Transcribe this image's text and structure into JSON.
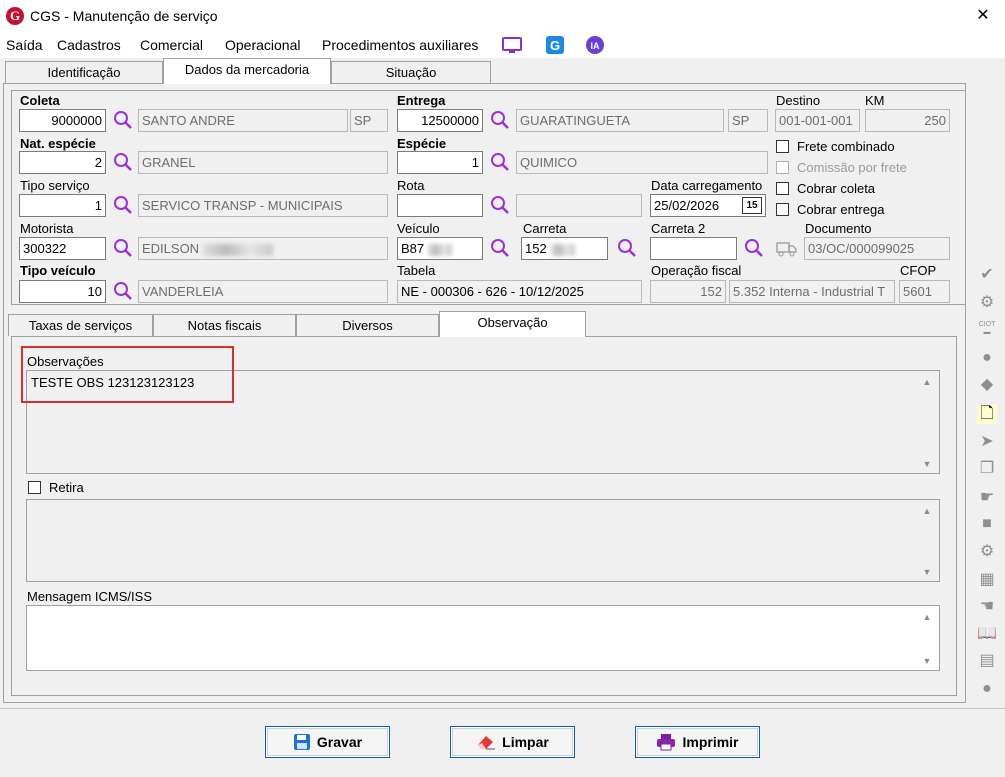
{
  "window": {
    "title": "CGS - Manutenção de serviço",
    "close": "✕",
    "logo_letter": "G"
  },
  "menu": {
    "items": [
      "Saída",
      "Cadastros",
      "Comercial",
      "Operacional",
      "Procedimentos auxiliares"
    ],
    "icons": [
      "monitor-icon",
      "g-logo-icon",
      "ia-icon"
    ],
    "ia_label": "IA"
  },
  "tabs": [
    "Identificação",
    "Dados da mercadoria",
    "Situação"
  ],
  "form": {
    "coleta": {
      "label": "Coleta",
      "code": "9000000",
      "name": "SANTO ANDRE",
      "uf": "SP"
    },
    "entrega": {
      "label": "Entrega",
      "code": "12500000",
      "name": "GUARATINGUETA",
      "uf": "SP"
    },
    "destino": {
      "label": "Destino",
      "value": "001-001-001"
    },
    "km": {
      "label": "KM",
      "value": "250"
    },
    "nat_especie": {
      "label": "Nat. espécie",
      "code": "2",
      "name": "GRANEL"
    },
    "especie": {
      "label": "Espécie",
      "code": "1",
      "name": "QUIMICO"
    },
    "tipo_servico": {
      "label": "Tipo serviço",
      "code": "1",
      "name": "SERVICO TRANSP - MUNICIPAIS"
    },
    "rota": {
      "label": "Rota",
      "code": "",
      "name": ""
    },
    "data_carregamento": {
      "label": "Data carregamento",
      "value": "25/02/2026",
      "cal": "15"
    },
    "motorista": {
      "label": "Motorista",
      "code": "300322",
      "name": "EDILSON"
    },
    "veiculo": {
      "label": "Veículo",
      "value": "B87"
    },
    "carreta": {
      "label": "Carreta",
      "value": "152"
    },
    "carreta2": {
      "label": "Carreta 2",
      "value": ""
    },
    "documento": {
      "label": "Documento",
      "value": "03/OC/000099025"
    },
    "tipo_veiculo": {
      "label": "Tipo veículo",
      "code": "10",
      "name": "VANDERLEIA"
    },
    "tabela": {
      "label": "Tabela",
      "value": "NE - 000306 - 626 - 10/12/2025"
    },
    "operacao_fiscal": {
      "label": "Operação fiscal",
      "code": "152",
      "value": "5.352  Interna - Industrial  T"
    },
    "cfop": {
      "label": "CFOP",
      "value": "5601"
    },
    "checks": {
      "frete_combinado": "Frete combinado",
      "comissao_por_frete": "Comissão por frete",
      "cobrar_coleta": "Cobrar coleta",
      "cobrar_entrega": "Cobrar entrega"
    }
  },
  "subtabs": [
    "Taxas de serviços",
    "Notas fiscais",
    "Diversos",
    "Observação"
  ],
  "observacao": {
    "obs_label": "Observações",
    "obs_value": "TESTE OBS 123123123123",
    "retira_label": "Retira",
    "msg_label": "Mensagem ICMS/ISS"
  },
  "buttons": {
    "gravar": "Gravar",
    "limpar": "Limpar",
    "imprimir": "Imprimir"
  },
  "sidebar_icons": [
    "check-icon",
    "truck-gear-icon",
    "ciot-icon",
    "circle-icon",
    "tag-icon",
    "document-icon",
    "document-arrow-icon",
    "documents-icon",
    "hand-truck-icon",
    "truck-icon",
    "truck-settings-icon",
    "grid-doc-icon",
    "hand-icon",
    "book-icon",
    "doc-gear-icon",
    "piggy-icon"
  ],
  "sidebar_ciot": "CIOT",
  "colors": {
    "accent": "#0b5eb0",
    "search": "#9b30d9",
    "highlight": "#d32f2f"
  }
}
